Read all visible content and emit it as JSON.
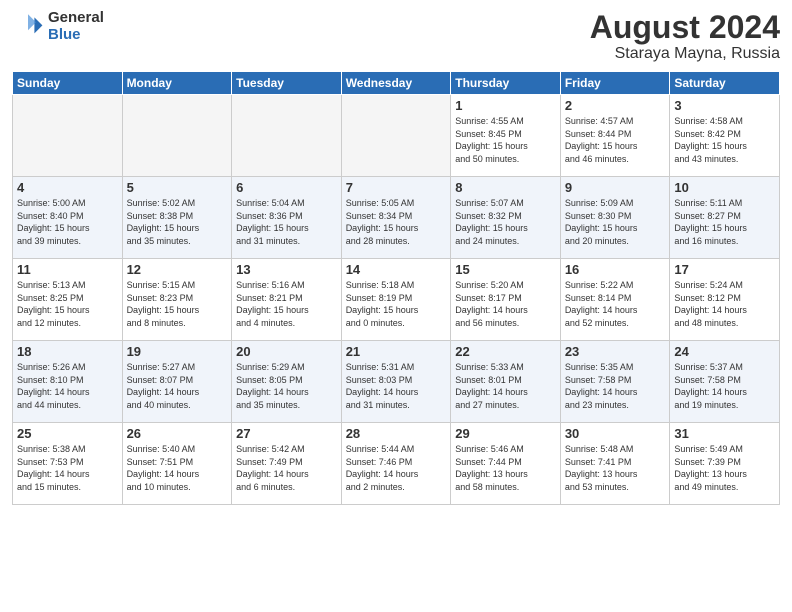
{
  "header": {
    "logo_general": "General",
    "logo_blue": "Blue",
    "month": "August 2024",
    "location": "Staraya Mayna, Russia"
  },
  "weekdays": [
    "Sunday",
    "Monday",
    "Tuesday",
    "Wednesday",
    "Thursday",
    "Friday",
    "Saturday"
  ],
  "weeks": [
    [
      {
        "day": "",
        "info": ""
      },
      {
        "day": "",
        "info": ""
      },
      {
        "day": "",
        "info": ""
      },
      {
        "day": "",
        "info": ""
      },
      {
        "day": "1",
        "info": "Sunrise: 4:55 AM\nSunset: 8:45 PM\nDaylight: 15 hours\nand 50 minutes."
      },
      {
        "day": "2",
        "info": "Sunrise: 4:57 AM\nSunset: 8:44 PM\nDaylight: 15 hours\nand 46 minutes."
      },
      {
        "day": "3",
        "info": "Sunrise: 4:58 AM\nSunset: 8:42 PM\nDaylight: 15 hours\nand 43 minutes."
      }
    ],
    [
      {
        "day": "4",
        "info": "Sunrise: 5:00 AM\nSunset: 8:40 PM\nDaylight: 15 hours\nand 39 minutes."
      },
      {
        "day": "5",
        "info": "Sunrise: 5:02 AM\nSunset: 8:38 PM\nDaylight: 15 hours\nand 35 minutes."
      },
      {
        "day": "6",
        "info": "Sunrise: 5:04 AM\nSunset: 8:36 PM\nDaylight: 15 hours\nand 31 minutes."
      },
      {
        "day": "7",
        "info": "Sunrise: 5:05 AM\nSunset: 8:34 PM\nDaylight: 15 hours\nand 28 minutes."
      },
      {
        "day": "8",
        "info": "Sunrise: 5:07 AM\nSunset: 8:32 PM\nDaylight: 15 hours\nand 24 minutes."
      },
      {
        "day": "9",
        "info": "Sunrise: 5:09 AM\nSunset: 8:30 PM\nDaylight: 15 hours\nand 20 minutes."
      },
      {
        "day": "10",
        "info": "Sunrise: 5:11 AM\nSunset: 8:27 PM\nDaylight: 15 hours\nand 16 minutes."
      }
    ],
    [
      {
        "day": "11",
        "info": "Sunrise: 5:13 AM\nSunset: 8:25 PM\nDaylight: 15 hours\nand 12 minutes."
      },
      {
        "day": "12",
        "info": "Sunrise: 5:15 AM\nSunset: 8:23 PM\nDaylight: 15 hours\nand 8 minutes."
      },
      {
        "day": "13",
        "info": "Sunrise: 5:16 AM\nSunset: 8:21 PM\nDaylight: 15 hours\nand 4 minutes."
      },
      {
        "day": "14",
        "info": "Sunrise: 5:18 AM\nSunset: 8:19 PM\nDaylight: 15 hours\nand 0 minutes."
      },
      {
        "day": "15",
        "info": "Sunrise: 5:20 AM\nSunset: 8:17 PM\nDaylight: 14 hours\nand 56 minutes."
      },
      {
        "day": "16",
        "info": "Sunrise: 5:22 AM\nSunset: 8:14 PM\nDaylight: 14 hours\nand 52 minutes."
      },
      {
        "day": "17",
        "info": "Sunrise: 5:24 AM\nSunset: 8:12 PM\nDaylight: 14 hours\nand 48 minutes."
      }
    ],
    [
      {
        "day": "18",
        "info": "Sunrise: 5:26 AM\nSunset: 8:10 PM\nDaylight: 14 hours\nand 44 minutes."
      },
      {
        "day": "19",
        "info": "Sunrise: 5:27 AM\nSunset: 8:07 PM\nDaylight: 14 hours\nand 40 minutes."
      },
      {
        "day": "20",
        "info": "Sunrise: 5:29 AM\nSunset: 8:05 PM\nDaylight: 14 hours\nand 35 minutes."
      },
      {
        "day": "21",
        "info": "Sunrise: 5:31 AM\nSunset: 8:03 PM\nDaylight: 14 hours\nand 31 minutes."
      },
      {
        "day": "22",
        "info": "Sunrise: 5:33 AM\nSunset: 8:01 PM\nDaylight: 14 hours\nand 27 minutes."
      },
      {
        "day": "23",
        "info": "Sunrise: 5:35 AM\nSunset: 7:58 PM\nDaylight: 14 hours\nand 23 minutes."
      },
      {
        "day": "24",
        "info": "Sunrise: 5:37 AM\nSunset: 7:58 PM\nDaylight: 14 hours\nand 19 minutes."
      }
    ],
    [
      {
        "day": "25",
        "info": "Sunrise: 5:38 AM\nSunset: 7:53 PM\nDaylight: 14 hours\nand 15 minutes."
      },
      {
        "day": "26",
        "info": "Sunrise: 5:40 AM\nSunset: 7:51 PM\nDaylight: 14 hours\nand 10 minutes."
      },
      {
        "day": "27",
        "info": "Sunrise: 5:42 AM\nSunset: 7:49 PM\nDaylight: 14 hours\nand 6 minutes."
      },
      {
        "day": "28",
        "info": "Sunrise: 5:44 AM\nSunset: 7:46 PM\nDaylight: 14 hours\nand 2 minutes."
      },
      {
        "day": "29",
        "info": "Sunrise: 5:46 AM\nSunset: 7:44 PM\nDaylight: 13 hours\nand 58 minutes."
      },
      {
        "day": "30",
        "info": "Sunrise: 5:48 AM\nSunset: 7:41 PM\nDaylight: 13 hours\nand 53 minutes."
      },
      {
        "day": "31",
        "info": "Sunrise: 5:49 AM\nSunset: 7:39 PM\nDaylight: 13 hours\nand 49 minutes."
      }
    ]
  ]
}
